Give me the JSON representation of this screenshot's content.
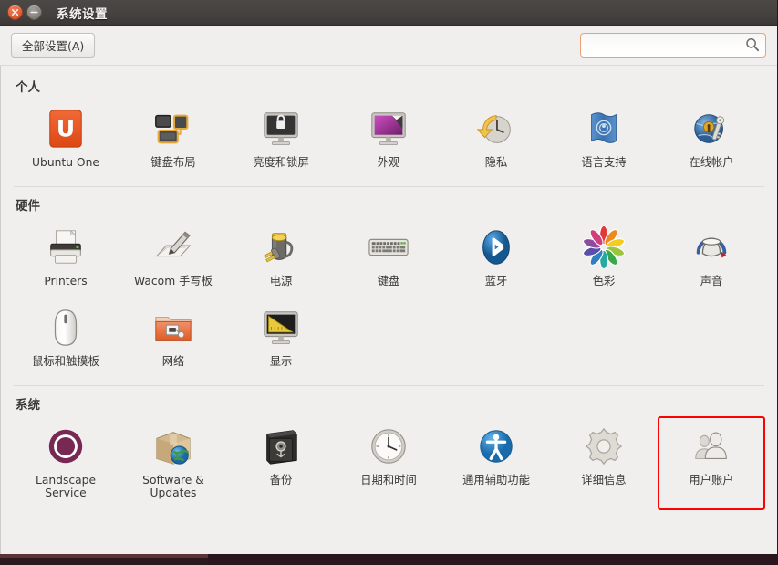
{
  "window": {
    "title": "系统设置",
    "close_label": "关闭",
    "minimize_label": "最小化"
  },
  "toolbar": {
    "all_settings_label": "全部设置(A)",
    "search_value": "",
    "search_placeholder": "",
    "search_icon": "search-icon"
  },
  "colors": {
    "accent_orange": "#e4663c",
    "highlight_red": "#ff0000",
    "titlebar": "#45423f",
    "content_bg": "#f0efed",
    "text": "#3a3936"
  },
  "sections": [
    {
      "title": "个人",
      "items": [
        {
          "label": "Ubuntu One",
          "icon": "ubuntu-one-icon"
        },
        {
          "label": "键盘布局",
          "icon": "keyboard-layout-icon"
        },
        {
          "label": "亮度和锁屏",
          "icon": "brightness-lock-icon"
        },
        {
          "label": "外观",
          "icon": "appearance-icon"
        },
        {
          "label": "隐私",
          "icon": "privacy-icon"
        },
        {
          "label": "语言支持",
          "icon": "language-support-icon"
        },
        {
          "label": "在线帐户",
          "icon": "online-accounts-icon"
        }
      ]
    },
    {
      "title": "硬件",
      "items": [
        {
          "label": "Printers",
          "icon": "printer-icon"
        },
        {
          "label": "Wacom 手写板",
          "icon": "wacom-tablet-icon"
        },
        {
          "label": "电源",
          "icon": "power-icon"
        },
        {
          "label": "键盘",
          "icon": "keyboard-icon"
        },
        {
          "label": "蓝牙",
          "icon": "bluetooth-icon"
        },
        {
          "label": "色彩",
          "icon": "color-icon"
        },
        {
          "label": "声音",
          "icon": "sound-icon"
        },
        {
          "label": "鼠标和触摸板",
          "icon": "mouse-touchpad-icon"
        },
        {
          "label": "网络",
          "icon": "network-icon"
        },
        {
          "label": "显示",
          "icon": "display-icon"
        }
      ]
    },
    {
      "title": "系统",
      "items": [
        {
          "label": "Landscape Service",
          "icon": "landscape-service-icon"
        },
        {
          "label": "Software & Updates",
          "icon": "software-updates-icon"
        },
        {
          "label": "备份",
          "icon": "backup-icon"
        },
        {
          "label": "日期和时间",
          "icon": "date-time-icon"
        },
        {
          "label": "通用辅助功能",
          "icon": "accessibility-icon"
        },
        {
          "label": "详细信息",
          "icon": "details-icon"
        },
        {
          "label": "用户账户",
          "icon": "user-accounts-icon",
          "highlighted": true
        }
      ]
    }
  ]
}
